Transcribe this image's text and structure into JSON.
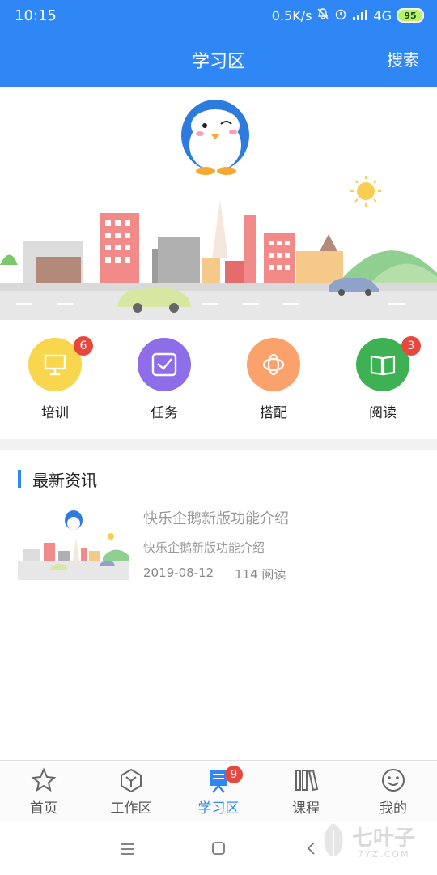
{
  "status_bar": {
    "time": "10:15",
    "network_speed": "0.5K/s",
    "network_type": "4G",
    "battery": "95"
  },
  "app_bar": {
    "title": "学习区",
    "search_label": "搜索"
  },
  "features": [
    {
      "label": "培训",
      "badge": "6",
      "color": "#f8d64e"
    },
    {
      "label": "任务",
      "badge": "",
      "color": "#8e6ee8"
    },
    {
      "label": "搭配",
      "badge": "",
      "color": "#fba16c"
    },
    {
      "label": "阅读",
      "badge": "3",
      "color": "#3eb153"
    }
  ],
  "news": {
    "section_title": "最新资讯",
    "items": [
      {
        "title": "快乐企鹅新版功能介绍",
        "subtitle": "快乐企鹅新版功能介绍",
        "date": "2019-08-12",
        "reads": "114 阅读"
      }
    ]
  },
  "tab_bar": {
    "tabs": [
      {
        "label": "首页"
      },
      {
        "label": "工作区"
      },
      {
        "label": "学习区",
        "badge": "9"
      },
      {
        "label": "课程"
      },
      {
        "label": "我的"
      }
    ]
  },
  "watermark": {
    "text": "七叶子",
    "sub": "7YZ.COM"
  },
  "colors": {
    "primary": "#2f87f5",
    "badge": "#e8473d"
  }
}
